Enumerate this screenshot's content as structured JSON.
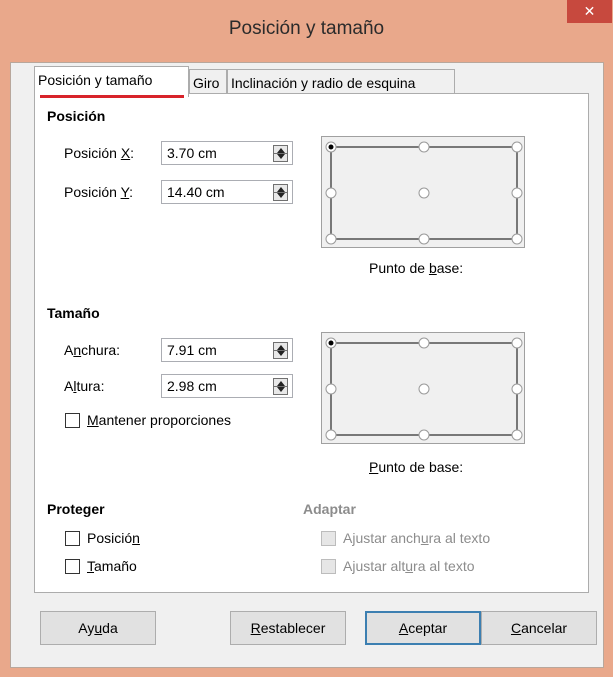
{
  "window": {
    "title": "Posición y tamaño",
    "close_glyph": "✕"
  },
  "tabs": [
    {
      "label": "Posición y tamaño",
      "active": true
    },
    {
      "label": "Giro",
      "active": false
    },
    {
      "label": "Inclinación y radio de esquina",
      "active": false
    }
  ],
  "position": {
    "title": "Posición",
    "x_label": "Posición X:",
    "x_label_pre": "Posición ",
    "x_label_key": "X",
    "x_label_post": ":",
    "x_value": "3.70 cm",
    "y_label": "Posición Y:",
    "y_label_pre": "Posición ",
    "y_label_key": "Y",
    "y_label_post": ":",
    "y_value": "14.40 cm",
    "base_point_label": "Punto de base:",
    "base_point_pre": "Punto de ",
    "base_point_key": "b",
    "base_point_post": "ase:",
    "base_point_selected": "top-left"
  },
  "size": {
    "title": "Tamaño",
    "width_pre": "A",
    "width_key": "n",
    "width_post": "chura:",
    "width_value": "7.91 cm",
    "height_pre": "A",
    "height_key": "l",
    "height_post": "tura:",
    "height_value": "2.98 cm",
    "keep_ratio_key": "M",
    "keep_ratio_post": "antener proporciones",
    "keep_ratio_checked": false,
    "base_point_key": "P",
    "base_point_post": "unto de base:",
    "base_point_selected": "top-left"
  },
  "protect": {
    "title": "Proteger",
    "position_pre": "Posició",
    "position_key": "n",
    "position_post": "",
    "position_checked": false,
    "size_pre": "",
    "size_key": "T",
    "size_post": "amaño",
    "size_checked": false
  },
  "adapt": {
    "title": "Adaptar",
    "fit_width_pre": "Ajustar anch",
    "fit_width_key": "u",
    "fit_width_post": "ra al texto",
    "fit_height_pre": "Ajustar alt",
    "fit_height_key": "u",
    "fit_height_post": "ra al texto",
    "enabled": false
  },
  "buttons": {
    "help_pre": "Ay",
    "help_key": "u",
    "help_post": "da",
    "reset_pre": "",
    "reset_key": "R",
    "reset_post": "establecer",
    "ok_pre": "",
    "ok_key": "A",
    "ok_post": "ceptar",
    "cancel_pre": "",
    "cancel_key": "C",
    "cancel_post": "ancelar"
  },
  "colors": {
    "titlebar": "#e9a88b",
    "close": "#c7493e",
    "tab_underline": "#d8232a",
    "default_button_border": "#3c7fb1"
  }
}
